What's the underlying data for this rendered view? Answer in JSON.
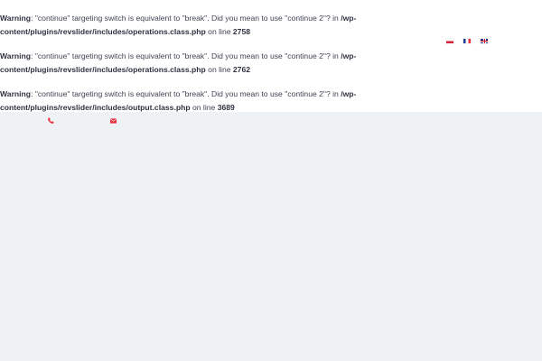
{
  "warnings": [
    {
      "label": "Warning",
      "message_prefix": ": \"continue\" targeting switch is equivalent to \"break\". Did you mean to use \"continue 2\"? in ",
      "path": "/wp-content/plugins/revslider/includes/operations.class.php",
      "line_prefix": " on line ",
      "line": "2758"
    },
    {
      "label": "Warning",
      "message_prefix": ": \"continue\" targeting switch is equivalent to \"break\". Did you mean to use \"continue 2\"? in ",
      "path": "/wp-content/plugins/revslider/includes/operations.class.php",
      "line_prefix": " on line ",
      "line": "2762"
    },
    {
      "label": "Warning",
      "message_prefix": ": \"continue\" targeting switch is equivalent to \"break\". Did you mean to use \"continue 2\"? in ",
      "path": "/wp-content/plugins/revslider/includes/output.class.php",
      "line_prefix": " on line ",
      "line": "3689"
    }
  ],
  "languages": [
    {
      "code": "pl",
      "icon": "flag-pl-icon"
    },
    {
      "code": "fr",
      "icon": "flag-fr-icon"
    },
    {
      "code": "en",
      "icon": "flag-gb-icon"
    }
  ],
  "contact": {
    "phone_icon": "phone-icon",
    "email_icon": "envelope-icon",
    "icon_color": "#e8303d"
  },
  "colors": {
    "text": "#3f4353",
    "background": "#eff2f5",
    "accent": "#e8303d"
  }
}
